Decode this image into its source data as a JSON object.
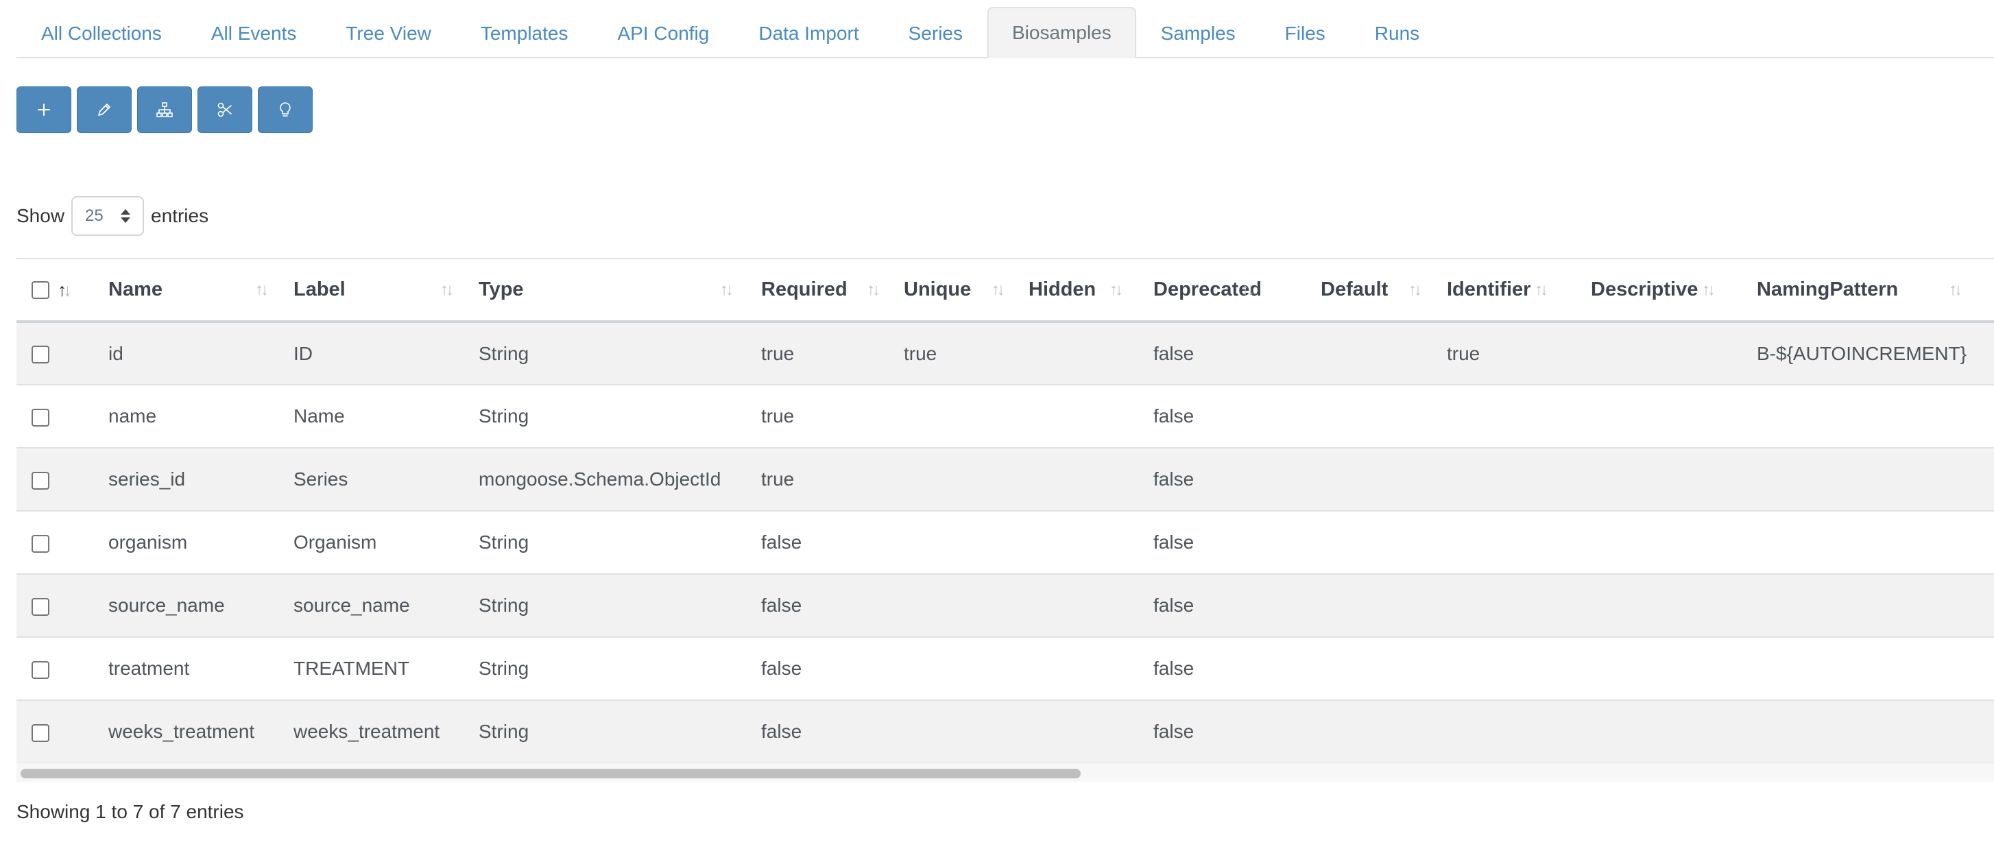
{
  "tabs": [
    {
      "label": "All Collections"
    },
    {
      "label": "All Events"
    },
    {
      "label": "Tree View"
    },
    {
      "label": "Templates"
    },
    {
      "label": "API Config"
    },
    {
      "label": "Data Import"
    },
    {
      "label": "Series"
    },
    {
      "label": "Biosamples",
      "active": true
    },
    {
      "label": "Samples"
    },
    {
      "label": "Files"
    },
    {
      "label": "Runs"
    }
  ],
  "toolbar": {
    "buttons": [
      {
        "icon": "plus-icon"
      },
      {
        "icon": "pencil-icon"
      },
      {
        "icon": "sitemap-icon"
      },
      {
        "icon": "scissors-icon"
      },
      {
        "icon": "lightbulb-icon"
      }
    ],
    "accent": "#4f88bb"
  },
  "length_control": {
    "prefix": "Show",
    "value": "25",
    "suffix": "entries"
  },
  "table": {
    "columns": [
      "Name",
      "Label",
      "Type",
      "Required",
      "Unique",
      "Hidden",
      "Deprecated",
      "Default",
      "Identifier",
      "Descriptive",
      "NamingPattern"
    ],
    "rows": [
      [
        "id",
        "ID",
        "String",
        "true",
        "true",
        "",
        "false",
        "",
        "true",
        "",
        "B-${AUTOINCREMENT}"
      ],
      [
        "name",
        "Name",
        "String",
        "true",
        "",
        "",
        "false",
        "",
        "",
        "",
        ""
      ],
      [
        "series_id",
        "Series",
        "mongoose.Schema.ObjectId",
        "true",
        "",
        "",
        "false",
        "",
        "",
        "",
        ""
      ],
      [
        "organism",
        "Organism",
        "String",
        "false",
        "",
        "",
        "false",
        "",
        "",
        "",
        ""
      ],
      [
        "source_name",
        "source_name",
        "String",
        "false",
        "",
        "",
        "false",
        "",
        "",
        "",
        ""
      ],
      [
        "treatment",
        "TREATMENT",
        "String",
        "false",
        "",
        "",
        "false",
        "",
        "",
        "",
        ""
      ],
      [
        "weeks_treatment",
        "weeks_treatment",
        "String",
        "false",
        "",
        "",
        "false",
        "",
        "",
        "",
        ""
      ]
    ]
  },
  "footer": {
    "info": "Showing 1 to 7 of 7 entries"
  }
}
